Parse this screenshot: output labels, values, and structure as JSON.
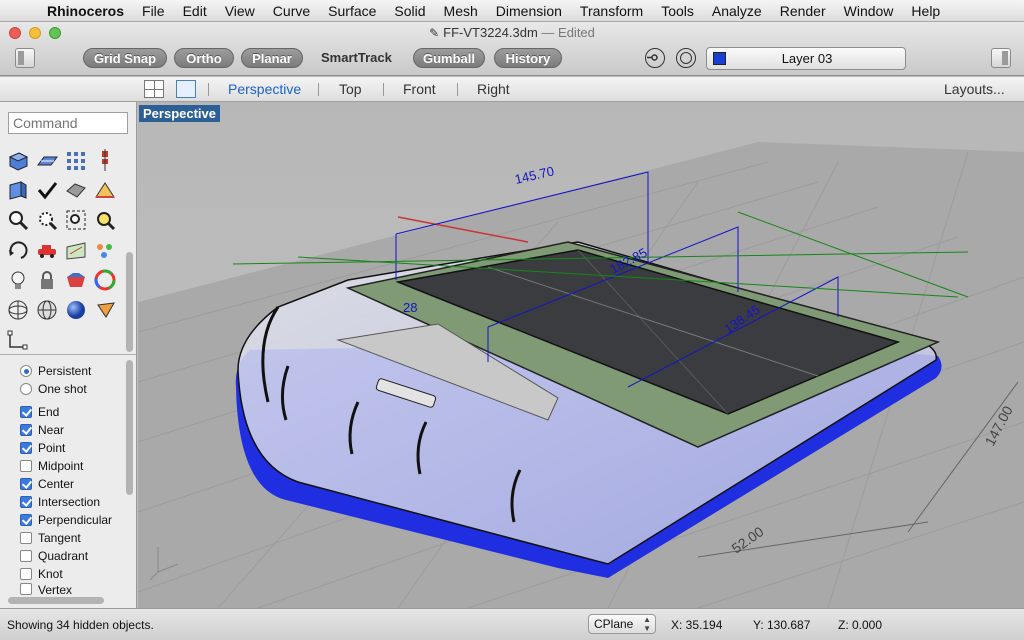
{
  "menubar": {
    "app_name": "Rhinoceros",
    "items": [
      "File",
      "Edit",
      "View",
      "Curve",
      "Surface",
      "Solid",
      "Mesh",
      "Dimension",
      "Transform",
      "Tools",
      "Analyze",
      "Render",
      "Window",
      "Help"
    ]
  },
  "window": {
    "doc_name": "FF-VT3224.3dm",
    "doc_status": "— Edited"
  },
  "toolbar": {
    "grid_snap": "Grid Snap",
    "ortho": "Ortho",
    "planar": "Planar",
    "smarttrack": "SmartTrack",
    "gumball": "Gumball",
    "history": "History",
    "layer_name": "Layer 03",
    "layer_color": "#1a3fd6"
  },
  "viewport_tabs": {
    "tabs": [
      "Perspective",
      "Top",
      "Front",
      "Right"
    ],
    "active": "Perspective",
    "layouts": "Layouts..."
  },
  "sidebar": {
    "command_placeholder": "Command",
    "osnap_mode": [
      {
        "label": "Persistent",
        "selected": true
      },
      {
        "label": "One shot",
        "selected": false
      }
    ],
    "osnaps": [
      {
        "label": "End",
        "checked": true
      },
      {
        "label": "Near",
        "checked": true
      },
      {
        "label": "Point",
        "checked": true
      },
      {
        "label": "Midpoint",
        "checked": false
      },
      {
        "label": "Center",
        "checked": true
      },
      {
        "label": "Intersection",
        "checked": true
      },
      {
        "label": "Perpendicular",
        "checked": true
      },
      {
        "label": "Tangent",
        "checked": false
      },
      {
        "label": "Quadrant",
        "checked": false
      },
      {
        "label": "Knot",
        "checked": false
      },
      {
        "label": "Vertex",
        "checked": false
      }
    ]
  },
  "viewport": {
    "label": "Perspective",
    "dimensions": {
      "d1": "145.70",
      "d2": "182.85",
      "d3": "138.45",
      "d4": "147.00",
      "d5": "52.00",
      "d6": "28"
    },
    "model_color": "#1f2ee0"
  },
  "status": {
    "message": "Showing 34 hidden objects.",
    "cplane": "CPlane",
    "x": "X: 35.194",
    "y": "Y: 130.687",
    "z": "Z: 0.000"
  }
}
